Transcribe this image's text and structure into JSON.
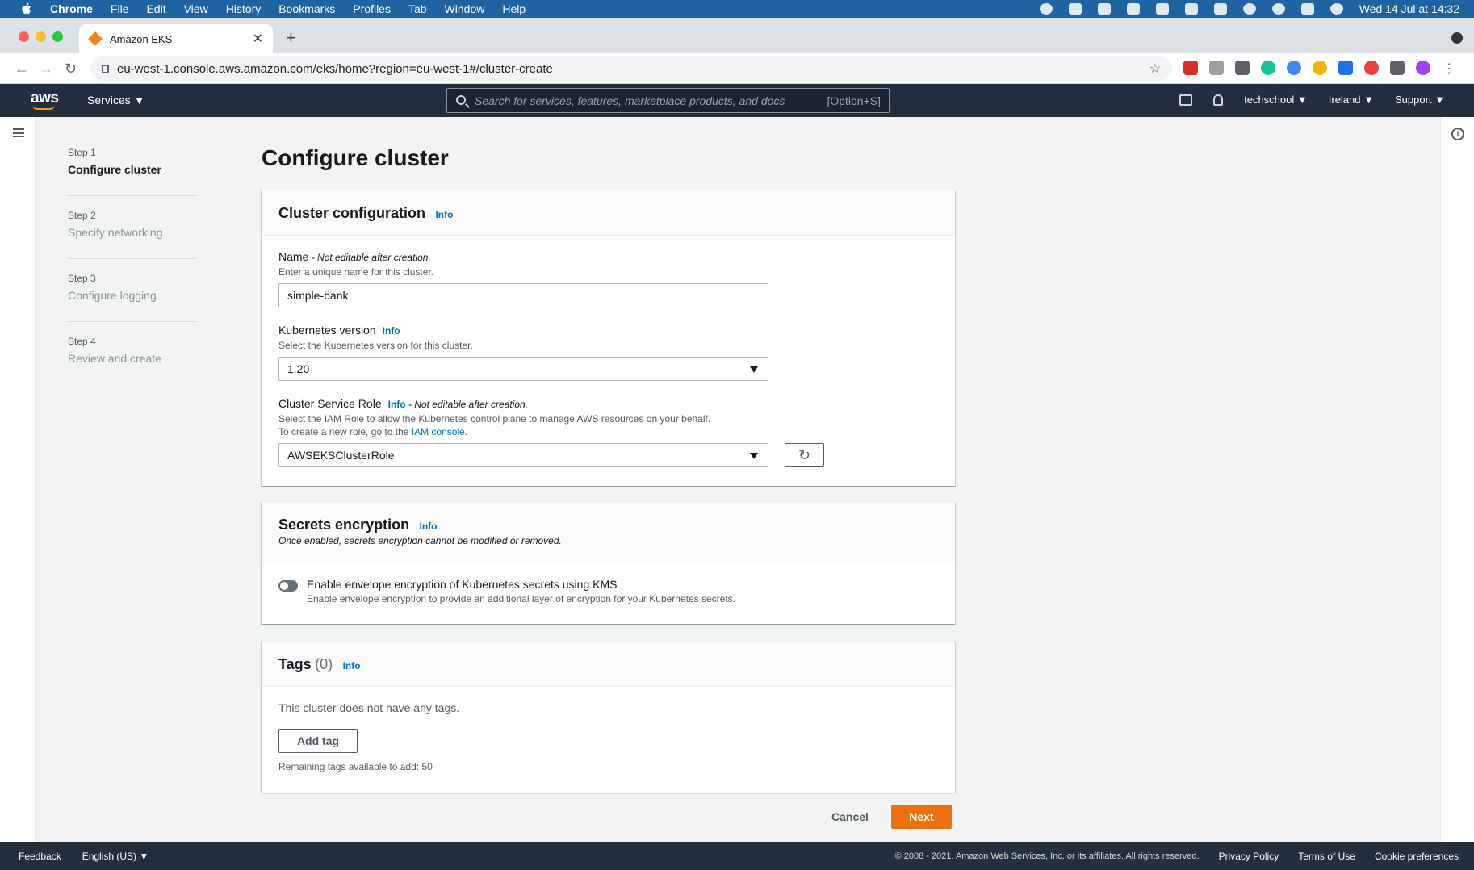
{
  "mac_menu": {
    "app": "Chrome",
    "items": [
      "File",
      "Edit",
      "View",
      "History",
      "Bookmarks",
      "Profiles",
      "Tab",
      "Window",
      "Help"
    ],
    "clock": "Wed 14 Jul at 14:32"
  },
  "browser": {
    "tab_title": "Amazon EKS",
    "url": "eu-west-1.console.aws.amazon.com/eks/home?region=eu-west-1#/cluster-create"
  },
  "aws_nav": {
    "logo": "aws",
    "services": "Services ▼",
    "search_placeholder": "Search for services, features, marketplace products, and docs",
    "search_shortcut": "[Option+S]",
    "account": "techschool ▼",
    "region": "Ireland ▼",
    "support": "Support ▼"
  },
  "steps": [
    {
      "num": "Step 1",
      "title": "Configure cluster"
    },
    {
      "num": "Step 2",
      "title": "Specify networking"
    },
    {
      "num": "Step 3",
      "title": "Configure logging"
    },
    {
      "num": "Step 4",
      "title": "Review and create"
    }
  ],
  "page_title": "Configure cluster",
  "info": "Info",
  "cluster_config": {
    "title": "Cluster configuration",
    "name_label": "Name",
    "name_note": " - Not editable after creation.",
    "name_desc": "Enter a unique name for this cluster.",
    "name_value": "simple-bank",
    "k8s_label": "Kubernetes version",
    "k8s_desc": "Select the Kubernetes version for this cluster.",
    "k8s_value": "1.20",
    "role_label": "Cluster Service Role",
    "role_note": " - Not editable after creation.",
    "role_desc": "Select the IAM Role to allow the Kubernetes control plane to manage AWS resources on your behalf.",
    "role_desc2": "To create a new role, go to the ",
    "iam_link": "IAM console",
    "role_value": "AWSEKSClusterRole"
  },
  "secrets": {
    "title": "Secrets encryption",
    "subtitle": "Once enabled, secrets encryption cannot be modified or removed.",
    "toggle_label": "Enable envelope encryption of Kubernetes secrets using KMS",
    "toggle_desc": "Enable envelope encryption to provide an additional layer of encryption for your Kubernetes secrets."
  },
  "tags": {
    "title": "Tags",
    "count": "(0)",
    "empty": "This cluster does not have any tags.",
    "add_button": "Add tag",
    "remaining": "Remaining tags available to add: 50"
  },
  "actions": {
    "cancel": "Cancel",
    "next": "Next"
  },
  "footer": {
    "feedback": "Feedback",
    "language": "English (US) ▼",
    "copyright": "© 2008 - 2021, Amazon Web Services, Inc. or its affiliates. All rights reserved.",
    "privacy": "Privacy Policy",
    "terms": "Terms of Use",
    "cookies": "Cookie preferences"
  }
}
